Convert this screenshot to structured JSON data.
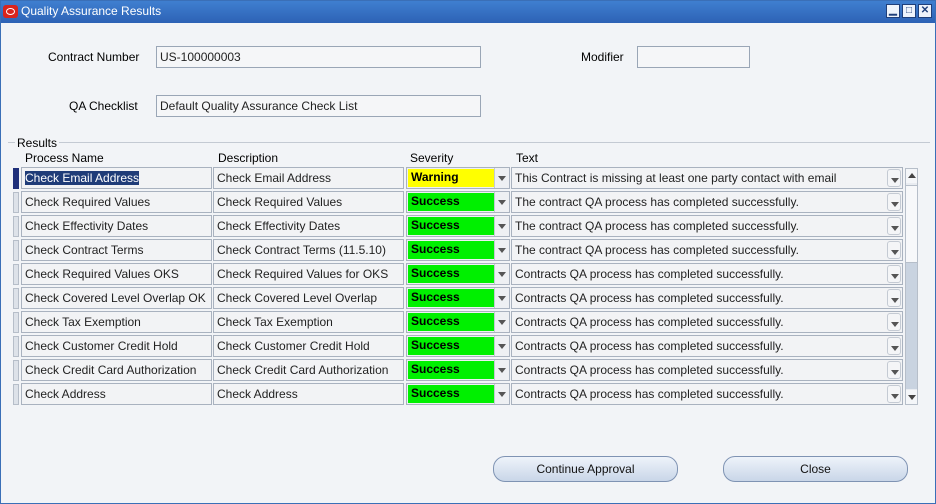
{
  "window": {
    "title": "Quality Assurance Results",
    "minimize": "▁",
    "maximize": "□",
    "close": "✕"
  },
  "header": {
    "contract_number_label": "Contract Number",
    "contract_number_value": "US-100000003",
    "modifier_label": "Modifier",
    "modifier_value": "",
    "qa_checklist_label": "QA Checklist",
    "qa_checklist_value": "Default Quality Assurance Check List"
  },
  "results": {
    "group_label": "Results",
    "columns": {
      "process_name": "Process Name",
      "description": "Description",
      "severity": "Severity",
      "text": "Text"
    },
    "rows": [
      {
        "process": "Check Email Address",
        "description": "Check Email Address",
        "severity": "Warning",
        "text": "This Contract is missing at least one party contact with email"
      },
      {
        "process": "Check Required Values",
        "description": "Check Required Values",
        "severity": "Success",
        "text": "The contract QA process has completed successfully."
      },
      {
        "process": "Check Effectivity Dates",
        "description": "Check Effectivity Dates",
        "severity": "Success",
        "text": "The contract QA process has completed successfully."
      },
      {
        "process": "Check Contract Terms",
        "description": "Check Contract Terms (11.5.10)",
        "severity": "Success",
        "text": "The contract QA process has completed successfully."
      },
      {
        "process": "Check Required Values OKS",
        "description": "Check Required Values for OKS",
        "severity": "Success",
        "text": "Contracts QA process has completed successfully."
      },
      {
        "process": "Check Covered Level Overlap OK",
        "description": "Check Covered Level Overlap",
        "severity": "Success",
        "text": "Contracts QA process has completed successfully."
      },
      {
        "process": "Check Tax Exemption",
        "description": "Check Tax Exemption",
        "severity": "Success",
        "text": "Contracts QA process has completed successfully."
      },
      {
        "process": "Check Customer Credit Hold",
        "description": "Check Customer Credit Hold",
        "severity": "Success",
        "text": "Contracts QA process has completed successfully."
      },
      {
        "process": "Check Credit Card Authorization",
        "description": "Check Credit Card Authorization",
        "severity": "Success",
        "text": "Contracts QA process has completed successfully."
      },
      {
        "process": "Check Address",
        "description": "Check Address",
        "severity": "Success",
        "text": "Contracts QA process has completed successfully."
      }
    ]
  },
  "buttons": {
    "continue_approval": "Continue Approval",
    "close": "Close"
  },
  "colors": {
    "warning": "#ffff00",
    "success": "#00f000",
    "titlebar": "#2d62b5"
  }
}
